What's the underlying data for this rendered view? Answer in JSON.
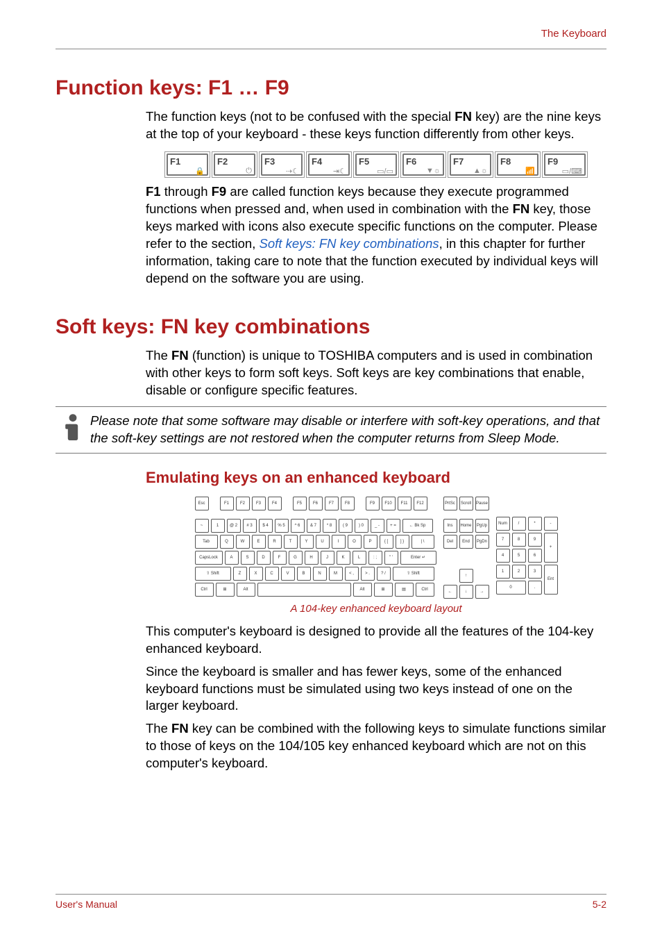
{
  "header": {
    "section": "The Keyboard"
  },
  "s1": {
    "title": "Function keys: F1 … F9",
    "p1a": "The function keys (not to be confused with the special ",
    "p1b": "FN",
    "p1c": " key) are the nine keys at the top of your keyboard - these keys function differently from other keys.",
    "p2a": "F1",
    "p2b": " through ",
    "p2c": "F9",
    "p2d": " are called function keys because they execute programmed functions when pressed and, when used in combination with the ",
    "p2e": "FN",
    "p2f": " key, those keys marked with icons also execute specific functions on the computer. Please refer to the section, ",
    "p2g": "Soft keys: FN key combinations",
    "p2h": ", in this chapter for further information, taking care to note that the function executed by individual keys will depend on the software you are using."
  },
  "fnkeys": {
    "f1": "F1",
    "f2": "F2",
    "f3": "F3",
    "f4": "F4",
    "f5": "F5",
    "f6": "F6",
    "f7": "F7",
    "f8": "F8",
    "f9": "F9"
  },
  "s2": {
    "title": "Soft keys: FN key combinations",
    "p1a": "The ",
    "p1b": "FN",
    "p1c": " (function) is unique to TOSHIBA computers and is used in combination with other keys to form soft keys. Soft keys are key combinations that enable, disable or configure specific features.",
    "note": "Please note that some software may disable or interfere with soft-key operations, and that the soft-key settings are not restored when the computer returns from Sleep Mode."
  },
  "s3": {
    "title": "Emulating keys on an enhanced keyboard",
    "caption": "A 104-key enhanced keyboard layout",
    "p1": "This computer's keyboard is designed to provide all the features of the 104-key enhanced keyboard.",
    "p2": "Since the keyboard is smaller and has fewer keys, some of the enhanced keyboard functions must be simulated using two keys instead of one on the larger keyboard.",
    "p3a": "The ",
    "p3b": "FN",
    "p3c": " key can be combined with the following keys to simulate functions similar to those of keys on the 104/105 key enhanced keyboard which are not on this computer's keyboard."
  },
  "kb": {
    "esc": "Esc",
    "f1": "F1",
    "f2": "F2",
    "f3": "F3",
    "f4": "F4",
    "f5": "F5",
    "f6": "F6",
    "f7": "F7",
    "f8": "F8",
    "f9": "F9",
    "f10": "F10",
    "f11": "F11",
    "f12": "F12",
    "prtsc": "PrtSc",
    "scroll": "Scroll",
    "pause": "Pause",
    "tilde": "~",
    "n1": "1",
    "n2": "@ 2",
    "n3": "# 3",
    "n4": "$ 4",
    "n5": "% 5",
    "n6": "^ 6",
    "n7": "& 7",
    "n8": "* 8",
    "n9": "( 9",
    "n0": ") 0",
    "dash": "_ -",
    "eq": "+ =",
    "bksp": "← Bk Sp",
    "tab": "Tab",
    "q": "Q",
    "w": "W",
    "e": "E",
    "r": "R",
    "t": "T",
    "y": "Y",
    "u": "U",
    "i": "I",
    "o": "O",
    "p": "P",
    "lb": "{ [",
    "rb": "] }",
    "bsl": "| \\",
    "caps": "CapsLock",
    "a": "A",
    "s": "S",
    "d": "D",
    "f": "F",
    "g": "G",
    "h": "H",
    "j": "J",
    "k": "K",
    "l": "L",
    "sc": ": ;",
    "qt": "\" '",
    "enter": "Enter ↵",
    "lshift": "⇧ Shift",
    "z": "Z",
    "x": "X",
    "c": "C",
    "v": "V",
    "b": "B",
    "n": "N",
    "m": "M",
    "cm": "< ,",
    "dot": "> .",
    "sl": "? /",
    "rshift": "⇧ Shift",
    "ctrl": "Ctrl",
    "win": "⊞",
    "alt": "Alt",
    "space": "",
    "ralt": "Alt",
    "rwin": "⊞",
    "menu": "▤",
    "rctrl": "Ctrl",
    "ins": "Ins",
    "home": "Home",
    "pgup": "PgUp",
    "del": "Del",
    "end": "End",
    "pgdn": "PgDn",
    "up": "↑",
    "left": "←",
    "down": "↓",
    "right": "→",
    "num": "Num",
    "div": "/",
    "mul": "*",
    "sub": "-",
    "k7": "7",
    "k8": "8",
    "k9": "9",
    "add": "+",
    "k4": "4",
    "k5": "5",
    "k6": "6",
    "k1": "1",
    "k2": "2",
    "k3": "3",
    "kent": "Ent",
    "k0": "0",
    "kdot": "."
  },
  "footer": {
    "left": "User's Manual",
    "right": "5-2"
  }
}
